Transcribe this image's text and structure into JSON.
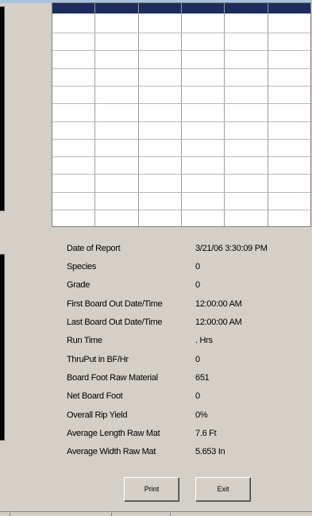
{
  "report": {
    "rows": [
      {
        "label": "Date of Report",
        "value": "3/21/06 3:30:09 PM"
      },
      {
        "label": "Species",
        "value": "0"
      },
      {
        "label": "Grade",
        "value": "0"
      },
      {
        "label": "First Board Out Date/Time",
        "value": "12:00:00 AM"
      },
      {
        "label": "Last Board Out Date/Time",
        "value": "12:00:00 AM"
      },
      {
        "label": "Run Time",
        "value": ". Hrs"
      },
      {
        "label": "ThruPut in BF/Hr",
        "value": "0"
      },
      {
        "label": "Board Foot Raw Material",
        "value": "651"
      },
      {
        "label": "Net Board Foot",
        "value": "0"
      },
      {
        "label": "Overall Rip Yield",
        "value": "0%"
      },
      {
        "label": "Average Length Raw Mat",
        "value": "7.6 Ft"
      },
      {
        "label": "Average Width Raw Mat",
        "value": "5.653 In"
      }
    ]
  },
  "buttons": {
    "print_label": "Print",
    "exit_label": "Exit"
  },
  "colors": {
    "window_bg": "#d4d0c8",
    "grid_header": "#1c2c5c",
    "grid_bg": "#ffffff"
  }
}
